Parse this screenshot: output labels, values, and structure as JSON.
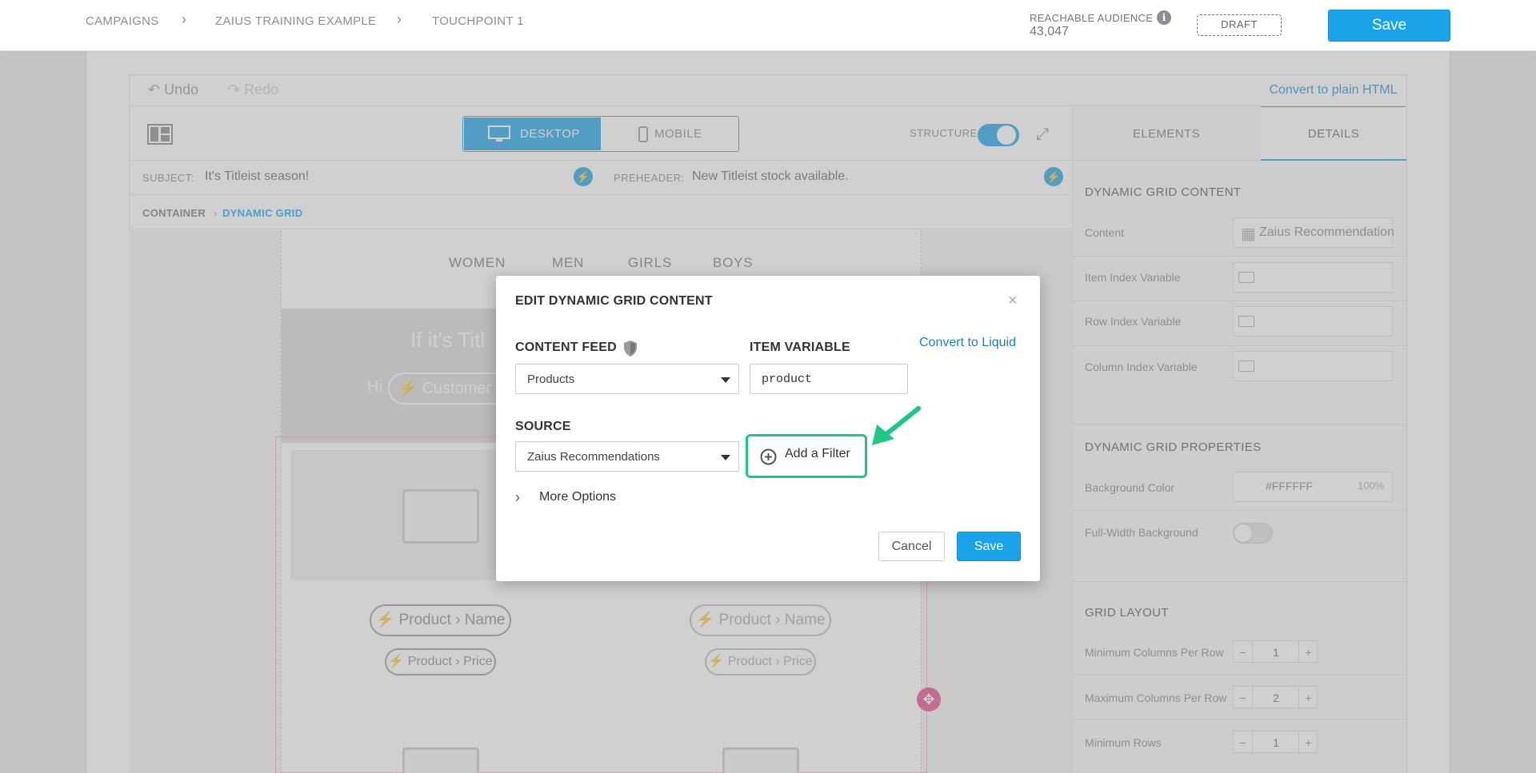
{
  "header": {
    "breadcrumbs": [
      "CAMPAIGNS",
      "ZAIUS TRAINING EXAMPLE",
      "TOUCHPOINT 1"
    ],
    "audience_label": "REACHABLE AUDIENCE",
    "audience_value": "43,047",
    "status": "DRAFT",
    "save_label": "Save"
  },
  "editor": {
    "undo_label": "Undo",
    "redo_label": "Redo",
    "plain_html_label": "Convert to plain HTML",
    "device_desktop": "DESKTOP",
    "device_mobile": "MOBILE",
    "structure_label": "STRUCTURE",
    "subject_label": "SUBJECT:",
    "subject_value": "It's Titleist season!",
    "preheader_label": "PREHEADER:",
    "preheader_value": "New Titleist stock available.",
    "breadcrumb_container": "CONTAINER",
    "breadcrumb_current": "DYNAMIC GRID"
  },
  "canvas": {
    "nav": [
      "WOMEN",
      "MEN",
      "GIRLS",
      "BOYS"
    ],
    "hero_title": "If it's Titl",
    "hero_hi": "Hi",
    "hero_pill": "Customer ›",
    "product_name_pill": "Product › Name",
    "product_price_pill": "Product › Price"
  },
  "right_panel": {
    "tabs": [
      "ELEMENTS",
      "DETAILS"
    ],
    "content_heading": "DYNAMIC GRID CONTENT",
    "content_label": "Content",
    "content_value": "Zaius Recommendation",
    "item_index_label": "Item Index Variable",
    "row_index_label": "Row Index Variable",
    "column_index_label": "Column Index Variable",
    "properties_heading": "DYNAMIC GRID PROPERTIES",
    "bg_color_label": "Background Color",
    "bg_color_value": "#FFFFFF",
    "bg_opacity_value": "100%",
    "full_width_label": "Full-Width Background",
    "layout_heading": "GRID LAYOUT",
    "min_cols_label": "Minimum Columns Per Row",
    "min_cols_value": "1",
    "max_cols_label": "Maximum Columns Per Row",
    "max_cols_value": "2",
    "min_rows_label": "Minimum Rows",
    "min_rows_value": "1",
    "stepper_minus": "−",
    "stepper_plus": "+"
  },
  "modal": {
    "title": "EDIT DYNAMIC GRID CONTENT",
    "close": "×",
    "content_feed_label": "CONTENT FEED",
    "content_feed_value": "Products",
    "item_variable_label": "ITEM VARIABLE",
    "item_variable_value": "product",
    "convert_liquid": "Convert to Liquid",
    "source_label": "SOURCE",
    "source_value": "Zaius Recommendations",
    "add_filter": "Add a Filter",
    "more_options": "More Options",
    "cancel": "Cancel",
    "save": "Save"
  },
  "colors": {
    "accent": "#1aa3e8",
    "highlight": "#1fc785",
    "selection": "#e84c8a"
  }
}
